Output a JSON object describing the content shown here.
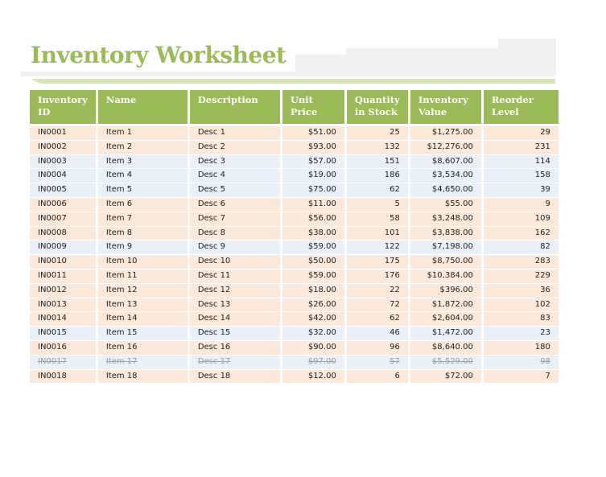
{
  "title": "Inventory Worksheet",
  "colors": {
    "accent": "#9bbb59",
    "accent_light": "#d8e4bc",
    "row_reorder": "#fde9d9",
    "row_ok": "#eaf0f8",
    "discontinued_text": "#a0a0a0"
  },
  "table": {
    "headers": [
      "Inventory ID",
      "Name",
      "Description",
      "Unit Price",
      "Quantity in Stock",
      "Inventory Value",
      "Reorder Level"
    ],
    "rows": [
      {
        "id": "IN0001",
        "name": "Item 1",
        "desc": "Desc 1",
        "price": "$51.00",
        "qty": "25",
        "value": "$1,275.00",
        "reorder": "29",
        "status": "reorder"
      },
      {
        "id": "IN0002",
        "name": "Item 2",
        "desc": "Desc 2",
        "price": "$93.00",
        "qty": "132",
        "value": "$12,276.00",
        "reorder": "231",
        "status": "reorder"
      },
      {
        "id": "IN0003",
        "name": "Item 3",
        "desc": "Desc 3",
        "price": "$57.00",
        "qty": "151",
        "value": "$8,607.00",
        "reorder": "114",
        "status": "ok"
      },
      {
        "id": "IN0004",
        "name": "Item 4",
        "desc": "Desc 4",
        "price": "$19.00",
        "qty": "186",
        "value": "$3,534.00",
        "reorder": "158",
        "status": "ok"
      },
      {
        "id": "IN0005",
        "name": "Item 5",
        "desc": "Desc 5",
        "price": "$75.00",
        "qty": "62",
        "value": "$4,650.00",
        "reorder": "39",
        "status": "ok"
      },
      {
        "id": "IN0006",
        "name": "Item 6",
        "desc": "Desc 6",
        "price": "$11.00",
        "qty": "5",
        "value": "$55.00",
        "reorder": "9",
        "status": "reorder"
      },
      {
        "id": "IN0007",
        "name": "Item 7",
        "desc": "Desc 7",
        "price": "$56.00",
        "qty": "58",
        "value": "$3,248.00",
        "reorder": "109",
        "status": "reorder"
      },
      {
        "id": "IN0008",
        "name": "Item 8",
        "desc": "Desc 8",
        "price": "$38.00",
        "qty": "101",
        "value": "$3,838.00",
        "reorder": "162",
        "status": "reorder"
      },
      {
        "id": "IN0009",
        "name": "Item 9",
        "desc": "Desc 9",
        "price": "$59.00",
        "qty": "122",
        "value": "$7,198.00",
        "reorder": "82",
        "status": "ok"
      },
      {
        "id": "IN0010",
        "name": "Item 10",
        "desc": "Desc 10",
        "price": "$50.00",
        "qty": "175",
        "value": "$8,750.00",
        "reorder": "283",
        "status": "reorder"
      },
      {
        "id": "IN0011",
        "name": "Item 11",
        "desc": "Desc 11",
        "price": "$59.00",
        "qty": "176",
        "value": "$10,384.00",
        "reorder": "229",
        "status": "reorder"
      },
      {
        "id": "IN0012",
        "name": "Item 12",
        "desc": "Desc 12",
        "price": "$18.00",
        "qty": "22",
        "value": "$396.00",
        "reorder": "36",
        "status": "reorder"
      },
      {
        "id": "IN0013",
        "name": "Item 13",
        "desc": "Desc 13",
        "price": "$26.00",
        "qty": "72",
        "value": "$1,872.00",
        "reorder": "102",
        "status": "reorder"
      },
      {
        "id": "IN0014",
        "name": "Item 14",
        "desc": "Desc 14",
        "price": "$42.00",
        "qty": "62",
        "value": "$2,604.00",
        "reorder": "83",
        "status": "reorder"
      },
      {
        "id": "IN0015",
        "name": "Item 15",
        "desc": "Desc 15",
        "price": "$32.00",
        "qty": "46",
        "value": "$1,472.00",
        "reorder": "23",
        "status": "ok"
      },
      {
        "id": "IN0016",
        "name": "Item 16",
        "desc": "Desc 16",
        "price": "$90.00",
        "qty": "96",
        "value": "$8,640.00",
        "reorder": "180",
        "status": "reorder"
      },
      {
        "id": "IN0017",
        "name": "Item 17",
        "desc": "Desc 17",
        "price": "$97.00",
        "qty": "57",
        "value": "$5,529.00",
        "reorder": "98",
        "status": "discontinued"
      },
      {
        "id": "IN0018",
        "name": "Item 18",
        "desc": "Desc 18",
        "price": "$12.00",
        "qty": "6",
        "value": "$72.00",
        "reorder": "7",
        "status": "reorder"
      }
    ]
  }
}
